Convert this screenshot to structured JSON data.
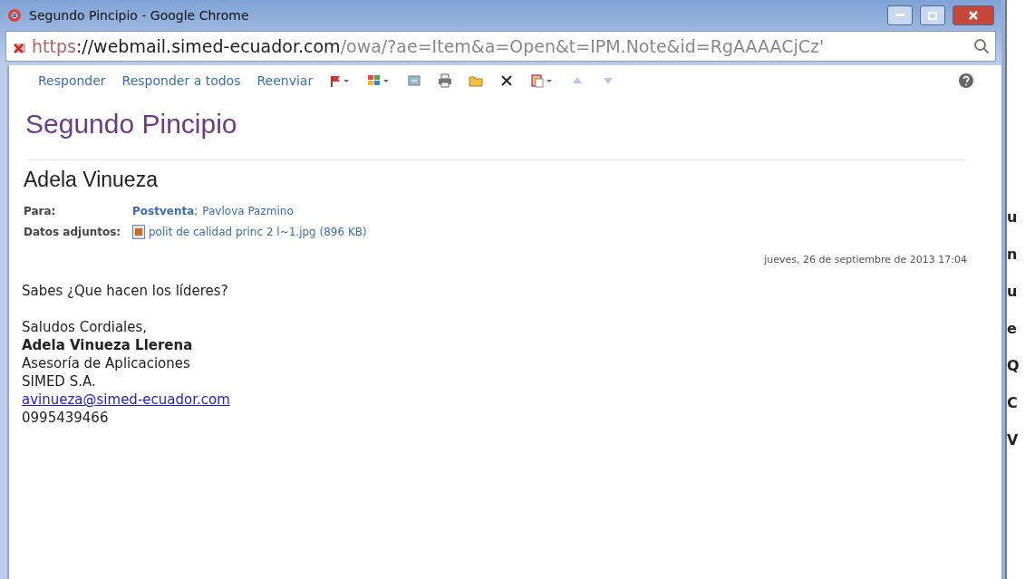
{
  "window": {
    "title": "Segundo Pincipio - Google Chrome"
  },
  "address_bar": {
    "scheme": "https",
    "host": "://webmail.simed-ecuador.com",
    "path": "/owa/?ae=Item&a=Open&t=IPM.Note&id=RgAAAACjCz'",
    "secure": false
  },
  "toolbar": {
    "actions": [
      "Responder",
      "Responder a todos",
      "Reenviar"
    ]
  },
  "message": {
    "subject": "Segundo Pincipio",
    "sender": "Adela Vinueza",
    "to_label": "Para:",
    "recipients": [
      {
        "name": "Postventa",
        "bold": true,
        "separator": ";"
      },
      {
        "name": "Pavlova Pazmino",
        "bold": false
      }
    ],
    "attachments_label": "Datos adjuntos:",
    "attachment": "polit de calidad princ 2 l~1.jpg (896 KB)",
    "date": "jueves, 26 de septiembre de 2013 17:04",
    "body": [
      {
        "kind": "text",
        "text": "Sabes ¿Que hacen los líderes?"
      },
      {
        "kind": "gap"
      },
      {
        "kind": "text",
        "text": "Saludos Cordiales,"
      },
      {
        "kind": "bold",
        "text": "Adela  Vinueza Llerena"
      },
      {
        "kind": "text",
        "text": "Asesoría de Aplicaciones"
      },
      {
        "kind": "text",
        "text": "SIMED S.A."
      },
      {
        "kind": "link",
        "text": "avinueza@simed-ecuador.com"
      },
      {
        "kind": "text",
        "text": "0995439466"
      }
    ]
  },
  "background_window": {
    "fragments": [
      "u",
      "n",
      "u",
      "e",
      "Q",
      "C",
      "V"
    ]
  }
}
